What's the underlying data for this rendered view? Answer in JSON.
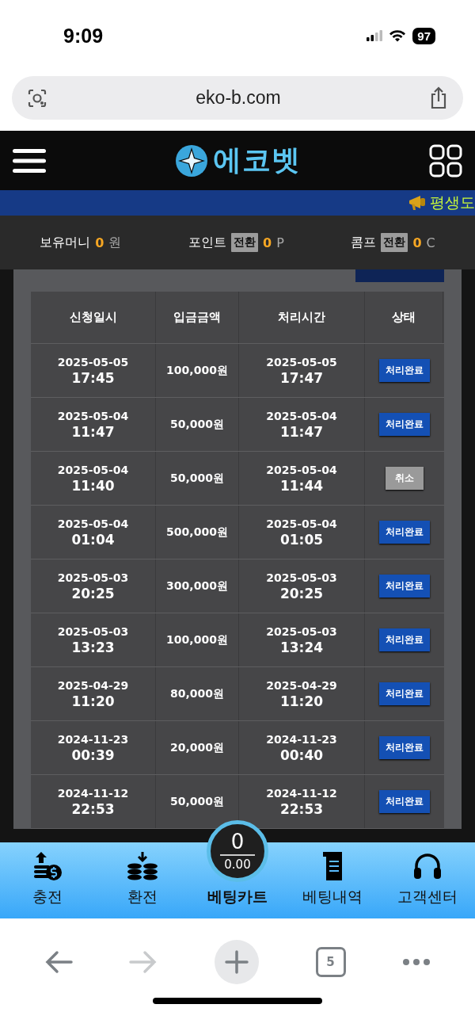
{
  "status_bar": {
    "time": "9:09",
    "battery": "97"
  },
  "browser": {
    "url": "eko-b.com",
    "tab_count": "5"
  },
  "header": {
    "logo": "에코벳"
  },
  "ticker": {
    "text": "평생도"
  },
  "balance": [
    {
      "label": "보유머니",
      "value": "0",
      "unit": "원"
    },
    {
      "label": "포인트",
      "convert": "전환",
      "value": "0",
      "unit": "P"
    },
    {
      "label": "콤프",
      "convert": "전환",
      "value": "0",
      "unit": "C"
    }
  ],
  "table": {
    "columns": [
      "신청일시",
      "입금금액",
      "처리시간",
      "상태"
    ],
    "rows": [
      {
        "requested_date": "2025-05-05",
        "requested_time": "17:45",
        "amount": "100,000원",
        "processed_date": "2025-05-05",
        "processed_time": "17:47",
        "status": "처리완료",
        "kind": "done"
      },
      {
        "requested_date": "2025-05-04",
        "requested_time": "11:47",
        "amount": "50,000원",
        "processed_date": "2025-05-04",
        "processed_time": "11:47",
        "status": "처리완료",
        "kind": "done"
      },
      {
        "requested_date": "2025-05-04",
        "requested_time": "11:40",
        "amount": "50,000원",
        "processed_date": "2025-05-04",
        "processed_time": "11:44",
        "status": "취소",
        "kind": "cancel"
      },
      {
        "requested_date": "2025-05-04",
        "requested_time": "01:04",
        "amount": "500,000원",
        "processed_date": "2025-05-04",
        "processed_time": "01:05",
        "status": "처리완료",
        "kind": "done"
      },
      {
        "requested_date": "2025-05-03",
        "requested_time": "20:25",
        "amount": "300,000원",
        "processed_date": "2025-05-03",
        "processed_time": "20:25",
        "status": "처리완료",
        "kind": "done"
      },
      {
        "requested_date": "2025-05-03",
        "requested_time": "13:23",
        "amount": "100,000원",
        "processed_date": "2025-05-03",
        "processed_time": "13:24",
        "status": "처리완료",
        "kind": "done"
      },
      {
        "requested_date": "2025-04-29",
        "requested_time": "11:20",
        "amount": "80,000원",
        "processed_date": "2025-04-29",
        "processed_time": "11:20",
        "status": "처리완료",
        "kind": "done"
      },
      {
        "requested_date": "2024-11-23",
        "requested_time": "00:39",
        "amount": "20,000원",
        "processed_date": "2024-11-23",
        "processed_time": "00:40",
        "status": "처리완료",
        "kind": "done"
      },
      {
        "requested_date": "2024-11-12",
        "requested_time": "22:53",
        "amount": "50,000원",
        "processed_date": "2024-11-12",
        "processed_time": "22:53",
        "status": "처리완료",
        "kind": "done"
      }
    ]
  },
  "bottom_nav": [
    {
      "kind": "deposit",
      "label": "충전"
    },
    {
      "kind": "withdraw",
      "label": "환전"
    },
    {
      "kind": "cart",
      "label": "베팅카트",
      "count": "0",
      "amount": "0.00"
    },
    {
      "kind": "history",
      "label": "베팅내역"
    },
    {
      "kind": "support",
      "label": "고객센터"
    }
  ]
}
